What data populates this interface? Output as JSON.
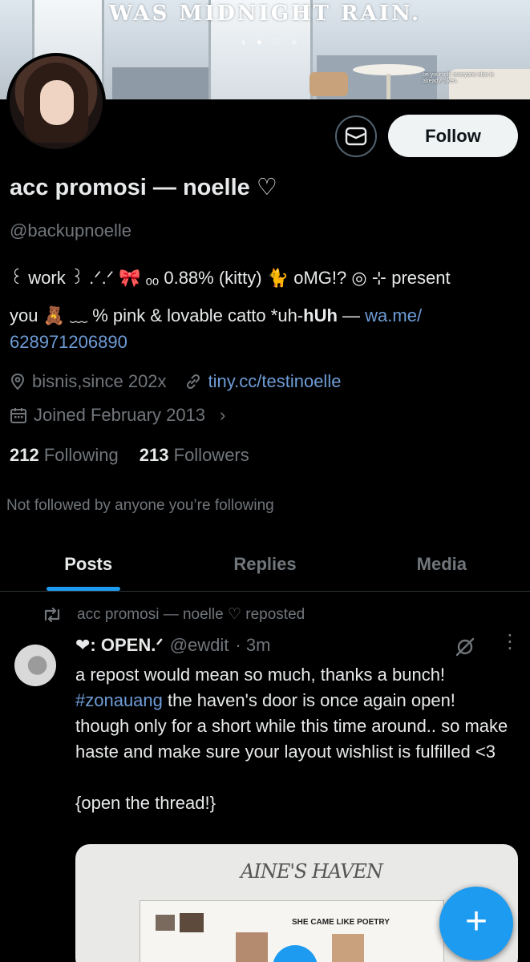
{
  "banner": {
    "title": "WAS MIDNIGHT RAIN.",
    "small_text": "be yourself; everyone else is already taken."
  },
  "profile": {
    "display_name": "acc promosi — noelle ♡",
    "handle": "@backupnoelle",
    "follow_label": "Follow",
    "bio_line1": "꒰ work ꒱ .ᐟ.ᐟ 🎀 ₒₒ 0.88% (kitty) 🐈 oMG!? ◎ ⊹ present",
    "bio_line2_text": "you 🧸 ﹏ % pink & lovable catto *uh-",
    "bio_line2_bold": "hUh",
    "bio_line2_dash": " — ",
    "bio_link": "wa.me/",
    "bio_link2": "628971206890",
    "location": "bisnis,since 202x",
    "website": "tiny.cc/testinoelle",
    "joined": "Joined February 2013",
    "following_count": "212",
    "following_label": "Following",
    "followers_count": "213",
    "followers_label": "Followers",
    "not_followed": "Not followed by anyone you’re following"
  },
  "tabs": [
    {
      "label": "Posts"
    },
    {
      "label": "Replies"
    },
    {
      "label": "Media"
    }
  ],
  "post": {
    "repost_label": "acc promosi — noelle ♡ reposted",
    "author": "❤︎: OPEN.ᐟ",
    "handle": "@ewdit",
    "time": "· 3m",
    "line1": "a repost would mean so much, thanks a bunch!",
    "hashtag": "#zonauang",
    "line2_rest": " the haven's door is once again open!",
    "line3": "though only for a short while this time around.. so make haste and make sure your layout wishlist is fulfilled <3",
    "line4": "{open the thread!}",
    "card_title": "AINE'S HAVEN",
    "card_poetry": "SHE CAME LIKE POETRY"
  },
  "fab_label": "+",
  "colors": {
    "accent": "#1d9bf0",
    "text": "#e7e9ea",
    "muted": "#71767b",
    "bg": "#000000"
  }
}
